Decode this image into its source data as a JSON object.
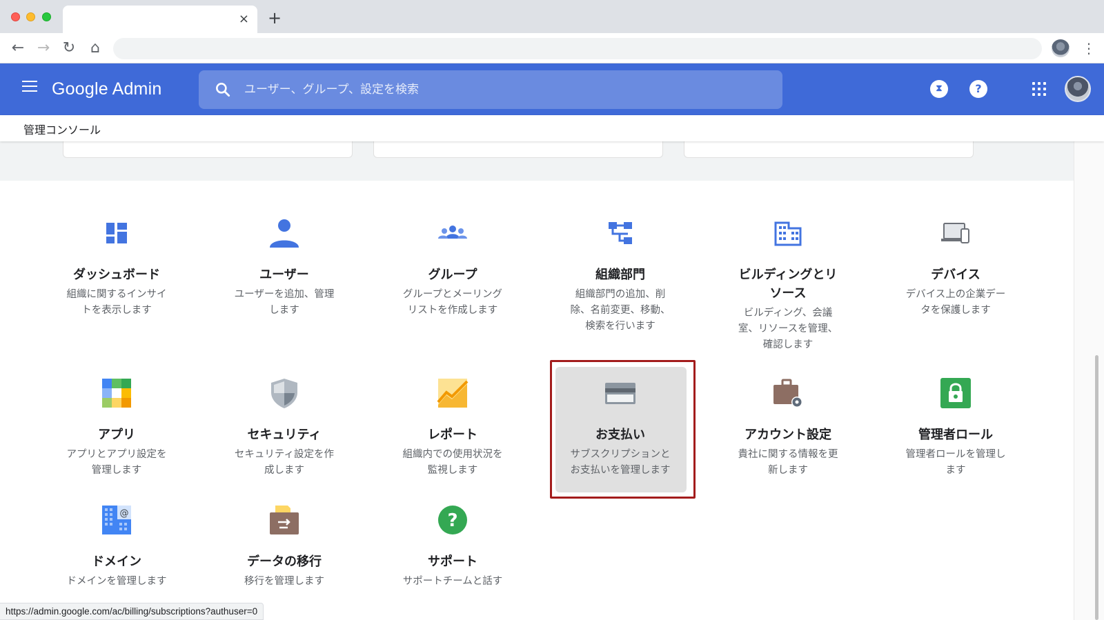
{
  "browser": {
    "tab_close": "×",
    "new_tab": "+",
    "nav": {
      "back": "←",
      "forward": "→",
      "reload": "↻",
      "home": "⌂"
    },
    "menu": "⋮"
  },
  "header": {
    "logo": "Google Admin",
    "search_placeholder": "ユーザー、グループ、設定を検索",
    "timer_icon": "⧗",
    "help_icon": "?"
  },
  "breadcrumb": "管理コンソール",
  "tiles": [
    {
      "id": "dashboard",
      "icon": "dashboard-icon",
      "title": "ダッシュボード",
      "desc": "組織に関するインサイ\nトを表示します"
    },
    {
      "id": "users",
      "icon": "user-icon",
      "title": "ユーザー",
      "desc": "ユーザーを追加、管理\nします"
    },
    {
      "id": "groups",
      "icon": "group-icon",
      "title": "グループ",
      "desc": "グループとメーリング\nリストを作成します"
    },
    {
      "id": "org-units",
      "icon": "org-units-icon",
      "title": "組織部門",
      "desc": "組織部門の追加、削\n除、名前変更、移動、\n検索を行います"
    },
    {
      "id": "buildings",
      "icon": "building-icon",
      "title": "ビルディングとリ\nソース",
      "desc": "ビルディング、会議\n室、リソースを管理、\n確認します"
    },
    {
      "id": "devices",
      "icon": "devices-icon",
      "title": "デバイス",
      "desc": "デバイス上の企業デー\nタを保護します"
    },
    {
      "id": "apps",
      "icon": "apps-icon",
      "title": "アプリ",
      "desc": "アプリとアプリ設定を\n管理します"
    },
    {
      "id": "security",
      "icon": "shield-icon",
      "title": "セキュリティ",
      "desc": "セキュリティ設定を作\n成します"
    },
    {
      "id": "reports",
      "icon": "report-chart-icon",
      "title": "レポート",
      "desc": "組織内での使用状況を\n監視します"
    },
    {
      "id": "billing",
      "icon": "credit-card-icon",
      "title": "お支払い",
      "desc": "サブスクリプションと\nお支払いを管理します"
    },
    {
      "id": "account",
      "icon": "account-settings-icon",
      "title": "アカウント設定",
      "desc": "貴社に関する情報を更\n新します"
    },
    {
      "id": "admin-roles",
      "icon": "admin-lock-icon",
      "title": "管理者ロール",
      "desc": "管理者ロールを管理し\nます"
    },
    {
      "id": "domains",
      "icon": "domain-icon",
      "title": "ドメイン",
      "desc": "ドメインを管理します"
    },
    {
      "id": "data-migration",
      "icon": "migration-box-icon",
      "title": "データの移行",
      "desc": "移行を管理します"
    },
    {
      "id": "support",
      "icon": "support-icon",
      "title": "サポート",
      "desc": "サポートチームと話す"
    }
  ],
  "status_url": "https://admin.google.com/ac/billing/subscriptions?authuser=0"
}
